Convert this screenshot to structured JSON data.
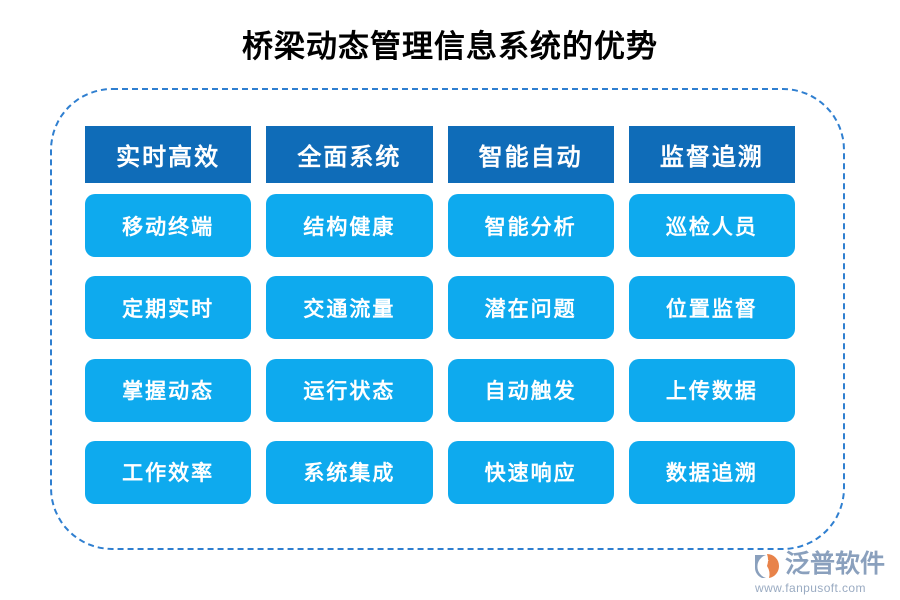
{
  "title": "桥梁动态管理信息系统的优势",
  "colors": {
    "header_blue": "#0f6cb8",
    "cell_blue": "#0eaaee",
    "dashed_border": "#2f7fd0",
    "title_text": "#000000",
    "logo_text": "#8aa0bd",
    "logo_accent_orange": "#e8834a"
  },
  "columns": [
    {
      "header": "实时高效",
      "items": [
        "移动终端",
        "定期实时",
        "掌握动态",
        "工作效率"
      ]
    },
    {
      "header": "全面系统",
      "items": [
        "结构健康",
        "交通流量",
        "运行状态",
        "系统集成"
      ]
    },
    {
      "header": "智能自动",
      "items": [
        "智能分析",
        "潜在问题",
        "自动触发",
        "快速响应"
      ]
    },
    {
      "header": "监督追溯",
      "items": [
        "巡检人员",
        "位置监督",
        "上传数据",
        "数据追溯"
      ]
    }
  ],
  "rows": [
    [
      "移动终端",
      "结构健康",
      "智能分析",
      "巡检人员"
    ],
    [
      "定期实时",
      "交通流量",
      "潜在问题",
      "位置监督"
    ],
    [
      "掌握动态",
      "运行状态",
      "自动触发",
      "上传数据"
    ],
    [
      "工作效率",
      "系统集成",
      "快速响应",
      "数据追溯"
    ]
  ],
  "logo": {
    "name": "泛普软件",
    "url": "www.fanpusoft.com"
  }
}
